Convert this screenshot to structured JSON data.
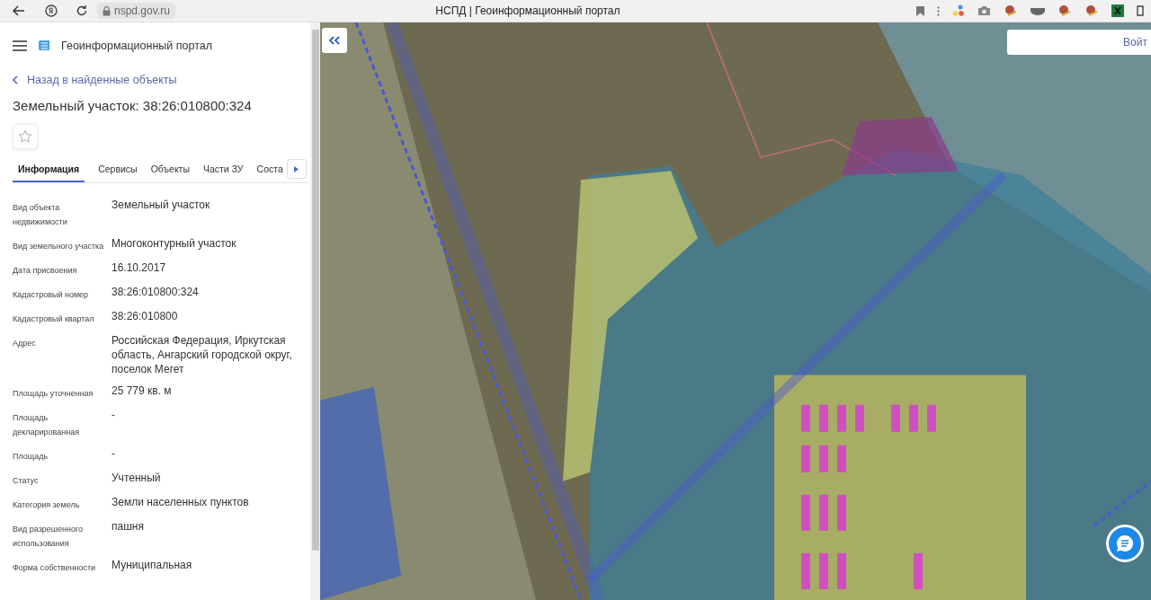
{
  "browser": {
    "address": "nspd.gov.ru",
    "title": "НСПД | Геоинформационный портал"
  },
  "panel": {
    "app_title": "Геоинформационный портал",
    "back_link": "Назад в найденные объекты",
    "heading": "Земельный участок: 38:26:010800:324",
    "favorite": false,
    "tabs": [
      {
        "label": "Информация",
        "selected": true
      },
      {
        "label": "Сервисы",
        "selected": false
      },
      {
        "label": "Объекты",
        "selected": false
      },
      {
        "label": "Части ЗУ",
        "selected": false
      },
      {
        "label": "Соста",
        "selected": false
      }
    ],
    "fields": [
      {
        "label": "Вид объекта недвижимости",
        "value": "Земельный участок"
      },
      {
        "label": "Вид земельного участка",
        "value": "Многоконтурный участок"
      },
      {
        "label": "Дата присвоения",
        "value": "16.10.2017"
      },
      {
        "label": "Кадастровый номер",
        "value": "38:26:010800:324"
      },
      {
        "label": "Кадастровый квартал",
        "value": "38:26:010800"
      },
      {
        "label": "Адрес",
        "value": "Российская Федерация, Иркутская область, Ангарский городской округ, поселок Мегет"
      },
      {
        "label": "Площадь уточненная",
        "value": "25 779 кв. м"
      },
      {
        "label": "Площадь декларированная",
        "value": "-"
      },
      {
        "label": "Площадь",
        "value": "-"
      },
      {
        "label": "Статус",
        "value": "Учтенный"
      },
      {
        "label": "Категория земель",
        "value": "Земли населенных пунктов"
      },
      {
        "label": "Вид разрешенного использования",
        "value": "пашня"
      },
      {
        "label": "Форма собственности",
        "value": "Муниципальная"
      }
    ]
  },
  "map": {
    "login_button": "Войт"
  }
}
